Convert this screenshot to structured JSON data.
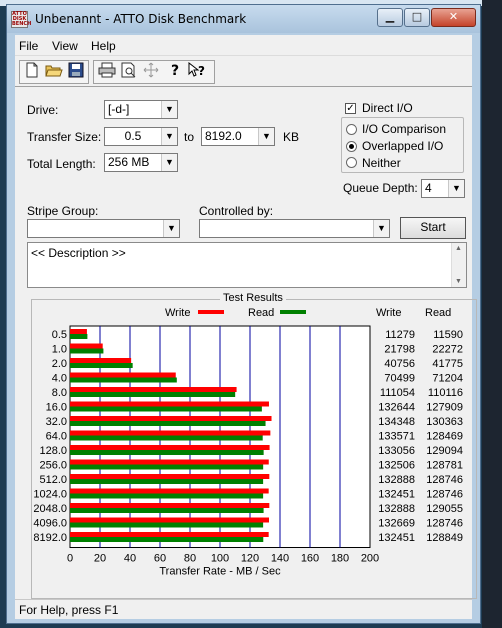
{
  "window": {
    "title": "Unbenannt - ATTO Disk Benchmark",
    "app_icon_text": "ATTO DISK BENCH"
  },
  "menu": [
    "File",
    "View",
    "Help"
  ],
  "toolbar": {
    "icons": [
      "new-icon",
      "open-icon",
      "save-icon",
      "print-icon",
      "print-preview-icon",
      "move-icon",
      "help-icon",
      "context-help-icon"
    ]
  },
  "settings": {
    "drive_label": "Drive:",
    "drive_value": "[-d-]",
    "transfer_size_label": "Transfer Size:",
    "transfer_from": "0.5",
    "to_label": "to",
    "transfer_to": "8192.0",
    "kb_label": "KB",
    "total_length_label": "Total Length:",
    "total_length_value": "256 MB",
    "direct_io_label": "Direct I/O",
    "direct_io_checked": true,
    "io_comparison_label": "I/O Comparison",
    "overlapped_io_label": "Overlapped I/O",
    "neither_label": "Neither",
    "selected_mode": "Overlapped I/O",
    "queue_depth_label": "Queue Depth:",
    "queue_depth_value": "4",
    "stripe_group_label": "Stripe Group:",
    "stripe_group_value": "",
    "controlled_by_label": "Controlled by:",
    "controlled_by_value": "",
    "start_label": "Start",
    "description": "<< Description >>"
  },
  "results": {
    "title": "Test Results",
    "write_legend": "Write",
    "read_legend": "Read",
    "write_col": "Write",
    "read_col": "Read",
    "xlabel": "Transfer Rate - MB / Sec",
    "colors": {
      "write": "#ff0000",
      "read": "#008000",
      "grid": "#0000a0"
    }
  },
  "chart_data": {
    "type": "bar",
    "orientation": "horizontal",
    "xlabel": "Transfer Rate - MB / Sec",
    "xlim": [
      0,
      200
    ],
    "x_ticks": [
      0,
      20,
      40,
      60,
      80,
      100,
      120,
      140,
      160,
      180,
      200
    ],
    "categories": [
      "0.5",
      "1.0",
      "2.0",
      "4.0",
      "8.0",
      "16.0",
      "32.0",
      "64.0",
      "128.0",
      "256.0",
      "512.0",
      "1024.0",
      "2048.0",
      "4096.0",
      "8192.0"
    ],
    "series": [
      {
        "name": "Write",
        "values": [
          11279,
          21798,
          40756,
          70499,
          111054,
          132644,
          134348,
          133571,
          133056,
          132506,
          132888,
          132451,
          132888,
          132669,
          132451
        ]
      },
      {
        "name": "Read",
        "values": [
          11590,
          22272,
          41775,
          71204,
          110116,
          127909,
          130363,
          128469,
          129094,
          128781,
          128746,
          128746,
          129055,
          128746,
          128849
        ]
      }
    ],
    "value_unit_scale": 1000,
    "legend": "top"
  },
  "status": "For Help, press F1"
}
